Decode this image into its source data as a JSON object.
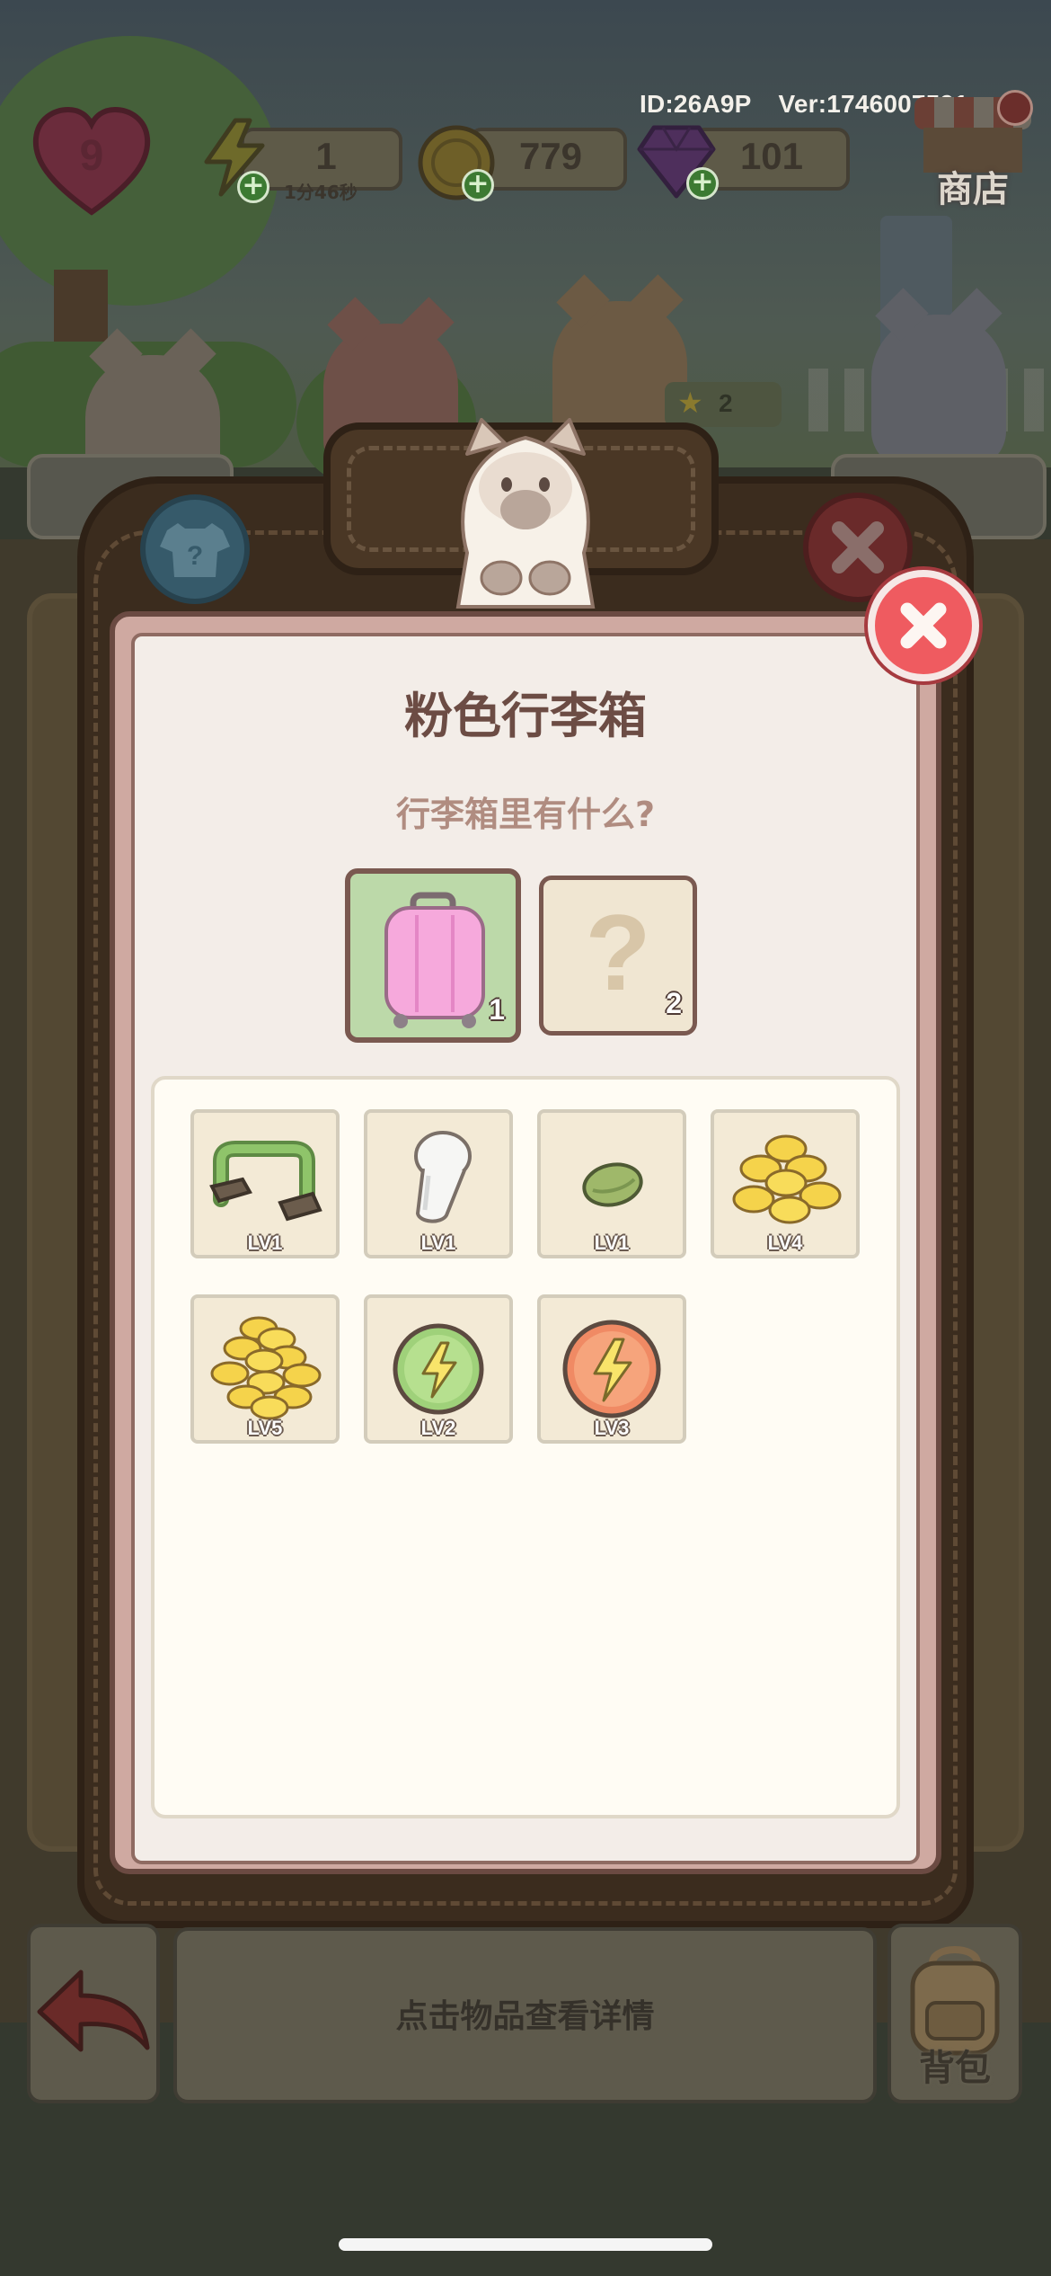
{
  "hud": {
    "id_text": "ID:26A9P",
    "ver_text": "Ver:1746007591",
    "lives": "9",
    "energy": "1",
    "energy_timer": "1分46秒",
    "coins": "779",
    "gems": "101",
    "shop_label": "商店"
  },
  "background": {
    "order_star_count": "2"
  },
  "dialog": {
    "title": "粉色行李箱",
    "subtitle": "行李箱里有什么?",
    "slots": [
      {
        "name": "pink-suitcase",
        "count": "1",
        "selected": true
      },
      {
        "name": "unknown",
        "symbol": "?",
        "count": "2",
        "selected": false
      }
    ],
    "items": [
      {
        "name": "green-handle",
        "level": "LV1"
      },
      {
        "name": "white-cup",
        "level": "LV1"
      },
      {
        "name": "green-seed",
        "level": "LV1"
      },
      {
        "name": "coin-pile",
        "level": "LV4"
      },
      {
        "name": "big-coin-pile",
        "level": "LV5"
      },
      {
        "name": "green-energy-token",
        "level": "LV2"
      },
      {
        "name": "orange-energy-token",
        "level": "LV3"
      }
    ]
  },
  "bottom_bar": {
    "hint": "点击物品查看详情",
    "bag_label": "背包"
  },
  "colors": {
    "close_button": "#ef5b60",
    "selected_slot": "#bcd9a9",
    "title_text": "#6c4c44"
  }
}
